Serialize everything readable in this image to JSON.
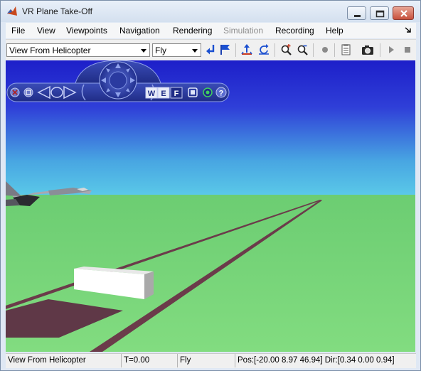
{
  "window": {
    "title": "VR Plane Take-Off"
  },
  "menu": [
    "File",
    "View",
    "Viewpoints",
    "Navigation",
    "Rendering",
    "Simulation",
    "Recording",
    "Help"
  ],
  "menu_disabled": "Simulation",
  "toolbar": {
    "viewpoint_select": "View From Helicopter",
    "navigation_mode_select": "Fly",
    "icons": [
      "return-to-viewpoint-icon",
      "create-viewpoint-icon",
      "straighten-up-icon",
      "undo-move-icon",
      "zoom-in-icon",
      "zoom-out-icon",
      "record-icon",
      "capture-settings-icon",
      "snapshot-icon",
      "play-icon",
      "stop-icon"
    ]
  },
  "scene": {
    "sky_top_color": "#1d1fc9",
    "sky_horizon_color": "#5ac8e8",
    "ground_color": "#78d67a",
    "runway_color": "#6b3b4a",
    "block_color": "#ffffff"
  },
  "nav_panel": {
    "letters": [
      "W",
      "E",
      "F"
    ],
    "icons": [
      "close-panel-icon",
      "minimize-panel-icon",
      "turn-left-icon",
      "turn-right-icon",
      "navigation-wheel-icon",
      "walk-mode-button",
      "examine-mode-button",
      "fly-mode-button",
      "straighten-icon",
      "headlight-icon",
      "help-icon"
    ]
  },
  "status": {
    "viewpoint": "View From Helicopter",
    "time": "T=0.00",
    "mode": "Fly",
    "position": "Pos:[-20.00 8.97 46.94] Dir:[0.34 0.00 0.94]"
  }
}
